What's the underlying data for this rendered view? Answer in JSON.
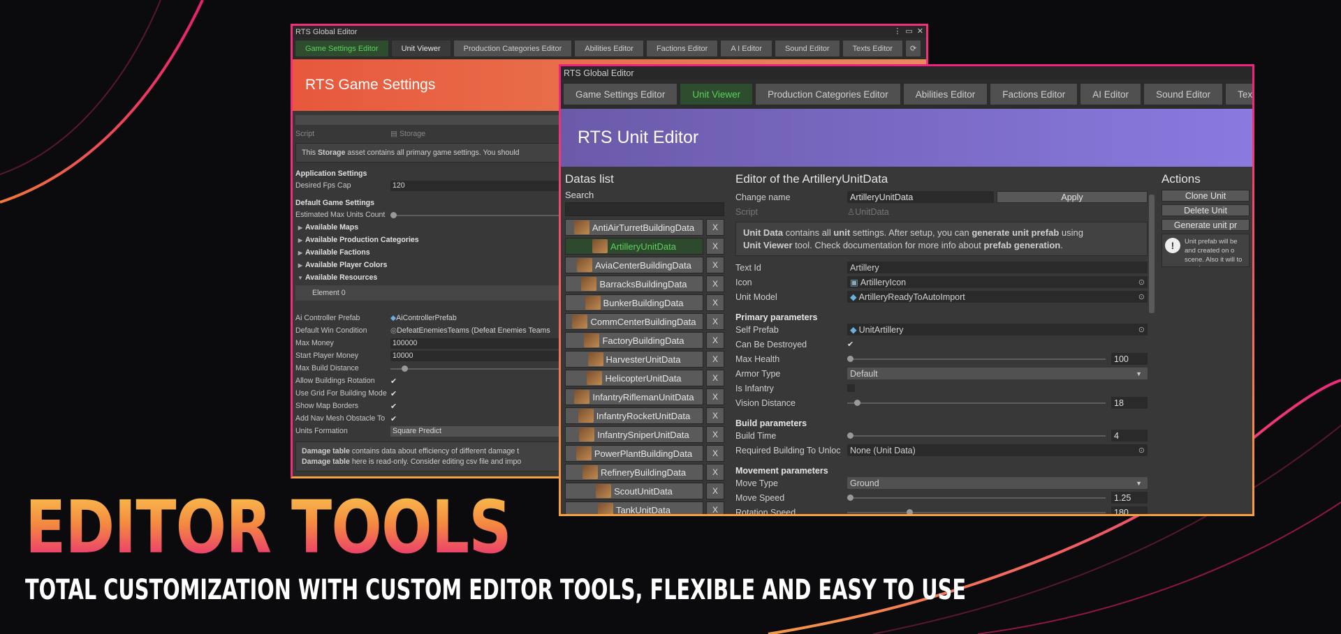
{
  "colors": {
    "accent_pink": "#e8206f",
    "accent_orange": "#f7a23c",
    "back_header": "#e7583c",
    "front_header": "#7a6ad0",
    "active_tab_green": "#5cd15c"
  },
  "hero": {
    "title": "EDITOR TOOLS",
    "subtitle": "TOTAL CUSTOMIZATION WITH CUSTOM EDITOR TOOLS, FLEXIBLE AND EASY TO USE"
  },
  "back_window": {
    "title": "RTS Global Editor",
    "tabs": [
      "Game Settings Editor",
      "Unit Viewer",
      "Production Categories Editor",
      "Abilities Editor",
      "Factions Editor",
      "A I Editor",
      "Sound Editor",
      "Texts Editor"
    ],
    "refresh_icon": "refresh-icon",
    "header": "RTS Game Settings",
    "script_label": "Script",
    "script_value": "Storage",
    "info_bold": "Storage",
    "info_pre": "This ",
    "info_post": " asset contains all primary game settings. You should",
    "app_settings": "Application Settings",
    "fps_label": "Desired Fps Cap",
    "fps_value": "120",
    "default_settings": "Default Game Settings",
    "max_units_label": "Estimated Max Units Count",
    "folds": [
      "Available Maps",
      "Available Production Categories",
      "Available Factions",
      "Available Player Colors",
      "Available Resources"
    ],
    "element0": "Element 0",
    "rows": [
      {
        "label": "Ai Controller Prefab",
        "value": "AiControllerPrefab"
      },
      {
        "label": "Default Win Condition",
        "value": "DefeatEnemiesTeams (Defeat Enemies Teams"
      },
      {
        "label": "Max Money",
        "value": "100000"
      },
      {
        "label": "Start Player Money",
        "value": "10000"
      }
    ],
    "max_build_label": "Max Build Distance",
    "checks": [
      "Allow Buildings Rotation",
      "Use Grid For Building Mode",
      "Show Map Borders",
      "Add Nav Mesh Obstacle To"
    ],
    "formation_label": "Units Formation",
    "formation_value": "Square Predict",
    "damage_b1": "Damage table",
    "damage_t1": " contains data about efficiency of different damage t",
    "damage_b2": "Damage table",
    "damage_t2": " here is read-only. Consider editing csv file and impo"
  },
  "front_window": {
    "title": "RTS Global Editor",
    "tabs": [
      "Game Settings Editor",
      "Unit Viewer",
      "Production Categories Editor",
      "Abilities Editor",
      "Factions Editor",
      "AI Editor",
      "Sound Editor",
      "Texts Edi"
    ],
    "header": "RTS Unit Editor",
    "list_title": "Datas list",
    "search_label": "Search",
    "items": [
      "AntiAirTurretBuildingData",
      "ArtilleryUnitData",
      "AviaCenterBuildingData",
      "BarracksBuildingData",
      "BunkerBuildingData",
      "CommCenterBuildingData",
      "FactoryBuildingData",
      "HarvesterUnitData",
      "HelicopterUnitData",
      "InfantryRiflemanUnitData",
      "InfantryRocketUnitData",
      "InfantrySniperUnitData",
      "PowerPlantBuildingData",
      "RefineryBuildingData",
      "ScoutUnitData",
      "TankUnitData"
    ],
    "remove_label": "X",
    "editor_title": "Editor of the ArtilleryUnitData",
    "change_name_label": "Change name",
    "change_name_value": "ArtilleryUnitData",
    "apply": "Apply",
    "script_label": "Script",
    "script_value": "UnitData",
    "info": {
      "b1": "Unit Data",
      "t1": " contains all ",
      "b2": "unit",
      "t2": " settings. After setup, you can ",
      "b3": "generate unit prefab",
      "t3": " using",
      "b4": "Unit Viewer",
      "t4": " tool. Check documentation for more info about ",
      "b5": "prefab generation",
      "t5": "."
    },
    "text_id_label": "Text Id",
    "text_id_value": "Artillery",
    "icon_label": "Icon",
    "icon_value": "ArtilleryIcon",
    "model_label": "Unit Model",
    "model_value": "ArtilleryReadyToAutoImport",
    "primary": "Primary parameters",
    "self_prefab_label": "Self Prefab",
    "self_prefab_value": "UnitArtillery",
    "destroy_label": "Can Be Destroyed",
    "health_label": "Max Health",
    "health_value": "100",
    "armor_label": "Armor Type",
    "armor_value": "Default",
    "infantry_label": "Is Infantry",
    "vision_label": "Vision Distance",
    "vision_value": "18",
    "build": "Build parameters",
    "build_time_label": "Build Time",
    "build_time_value": "4",
    "req_label": "Required Building To Unloc",
    "req_value": "None (Unit Data)",
    "movement": "Movement parameters",
    "move_type_label": "Move Type",
    "move_type_value": "Ground",
    "move_speed_label": "Move Speed",
    "move_speed_value": "1.25",
    "rot_label": "Rotation Speed",
    "rot_value": "180",
    "actions_title": "Actions",
    "actions": [
      "Clone Unit",
      "Delete Unit",
      "Generate unit pr"
    ],
    "action_info": "Unit prefab will be and created on o scene. Also it will to assets."
  }
}
